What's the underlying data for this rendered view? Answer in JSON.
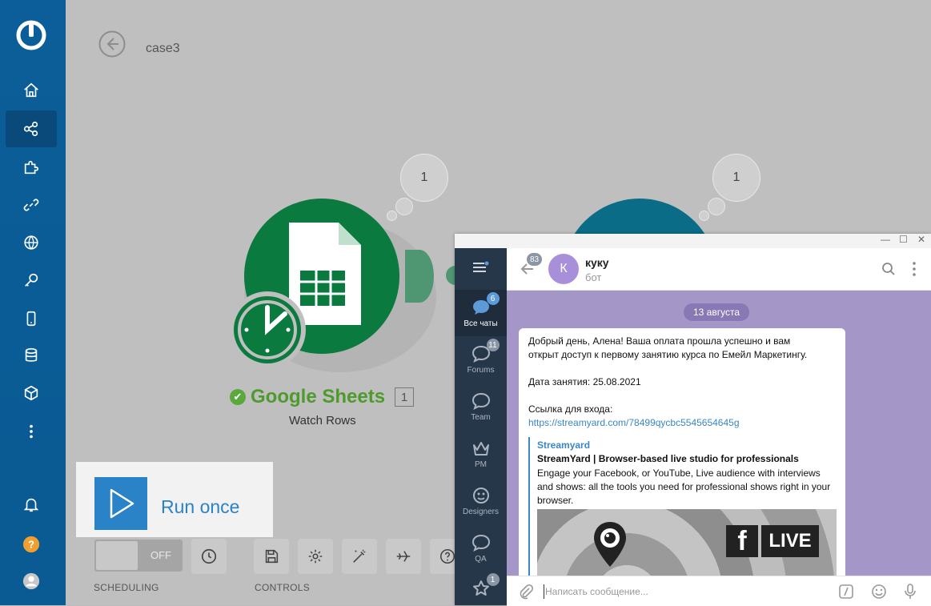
{
  "scenario": {
    "name": "case3"
  },
  "module": {
    "title": "Google Sheets",
    "count": "1",
    "subtitle": "Watch Rows",
    "bubble_left": "1",
    "bubble_right": "1"
  },
  "run_once": {
    "label": "Run once"
  },
  "scheduling": {
    "toggle_label": "OFF",
    "section_label": "SCHEDULING"
  },
  "controls": {
    "section_label": "CONTROLS"
  },
  "telegram": {
    "back_badge": "83",
    "chat": {
      "avatar_letter": "К",
      "name": "куку",
      "status": "бот"
    },
    "folders": [
      {
        "label": "Все чаты",
        "badge": "6"
      },
      {
        "label": "Forums",
        "badge": "11"
      },
      {
        "label": "Team",
        "badge": ""
      },
      {
        "label": "PM",
        "badge": ""
      },
      {
        "label": "Designers",
        "badge": ""
      },
      {
        "label": "QA",
        "badge": ""
      },
      {
        "label": "",
        "badge": "1"
      }
    ],
    "date": "13 августа",
    "message": {
      "line1": "Добрый день, Алена! Ваша оплата прошла успешно и вам",
      "line2": "открыт доступ к первому занятию курса по Емейл Маркетингу.",
      "date_line": "Дата занятия: 25.08.2021",
      "link_label": "Ссылка для входа:",
      "link": "https://streamyard.com/78499qycbc5545654645g",
      "preview": {
        "site": "Streamyard",
        "title": "StreamYard | Browser-based live studio for professionals",
        "description": "Engage your Facebook, or YouTube, Live audience with interviews and shows: all the tools you need for professional shows right in your browser.",
        "live_label": "LIVE"
      }
    },
    "input_placeholder": "Написать сообщение..."
  }
}
